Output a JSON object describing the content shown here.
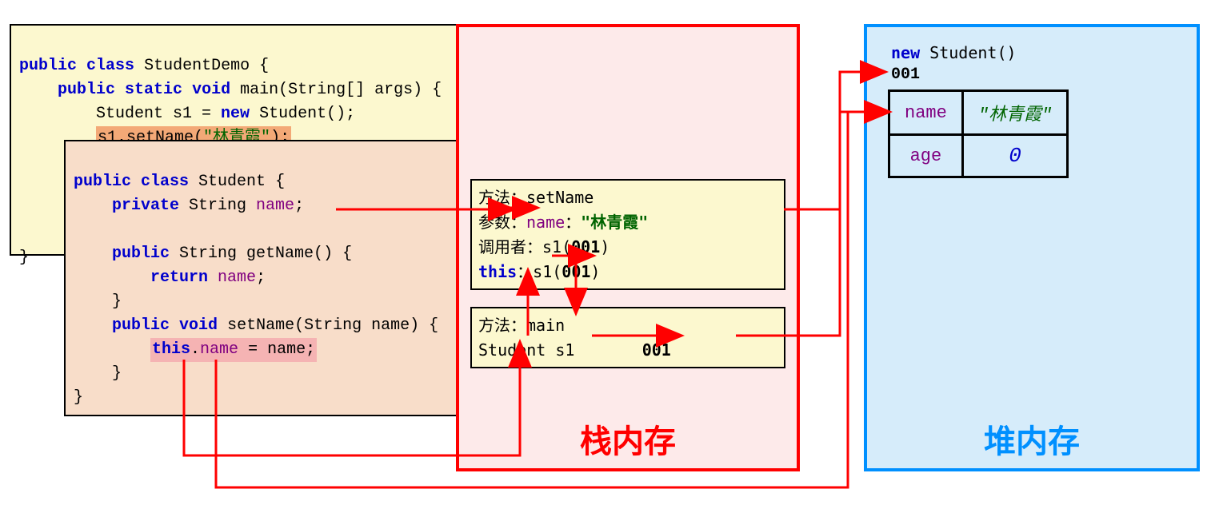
{
  "code_outer": {
    "l1_public": "public",
    "l1_class": "class",
    "l1_name": "StudentDemo {",
    "l2_indent": "    ",
    "l2_public": "public",
    "l2_static": "static",
    "l2_void": "void",
    "l2_rest": " main(String[] args) {",
    "l3_indent": "        ",
    "l3_text_a": "Student s1 = ",
    "l3_new": "new",
    "l3_text_b": " Student();",
    "l4_indent": "        ",
    "l4_call_a": "s1.setName(",
    "l4_str": "\"林青霞\"",
    "l4_call_b": ");",
    "l_end": "}"
  },
  "code_inner": {
    "l1_public": "public",
    "l1_class": "class",
    "l1_name": " Student {",
    "l2_indent": "    ",
    "l2_private": "private",
    "l2_rest_a": " String ",
    "l2_field": "name",
    "l2_rest_b": ";",
    "l4_indent": "    ",
    "l4_public": "public",
    "l4_rest": " String getName() {",
    "l5_indent": "        ",
    "l5_return": "return",
    "l5_rest_a": " ",
    "l5_field": "name",
    "l5_rest_b": ";",
    "l6_indent": "    }",
    "l7_indent": "    ",
    "l7_public": "public",
    "l7_void": "void",
    "l7_rest": " setName(String name) {",
    "l8_indent": "        ",
    "l8_this": "this",
    "l8_dot": ".",
    "l8_field": "name",
    "l8_rest": " = name;",
    "l9_indent": "    }",
    "l10": "}"
  },
  "stack": {
    "title": "栈内存",
    "frame_set": {
      "l1_label": "方法：",
      "l1_val": "setName",
      "l2_label": "参数：",
      "l2_name": "name",
      "l2_colon": "：",
      "l2_val": "\"林青霞\"",
      "l3_label": "调用者：",
      "l3_val_a": "s1(",
      "l3_val_b": "001",
      "l3_val_c": ")",
      "l4_this": "this",
      "l4_colon": "：",
      "l4_val_a": "s1(",
      "l4_val_b": "001",
      "l4_val_c": ")"
    },
    "frame_main": {
      "l1_label": "方法：",
      "l1_val": "main",
      "l2_a": " Student s1",
      "l2_b": "001"
    }
  },
  "heap": {
    "title": "堆内存",
    "new_kw": "new",
    "new_rest": " Student()",
    "addr": "001",
    "row1_field": "name",
    "row1_val": "\"林青霞\"",
    "row2_field": "age",
    "row2_val": "0"
  }
}
